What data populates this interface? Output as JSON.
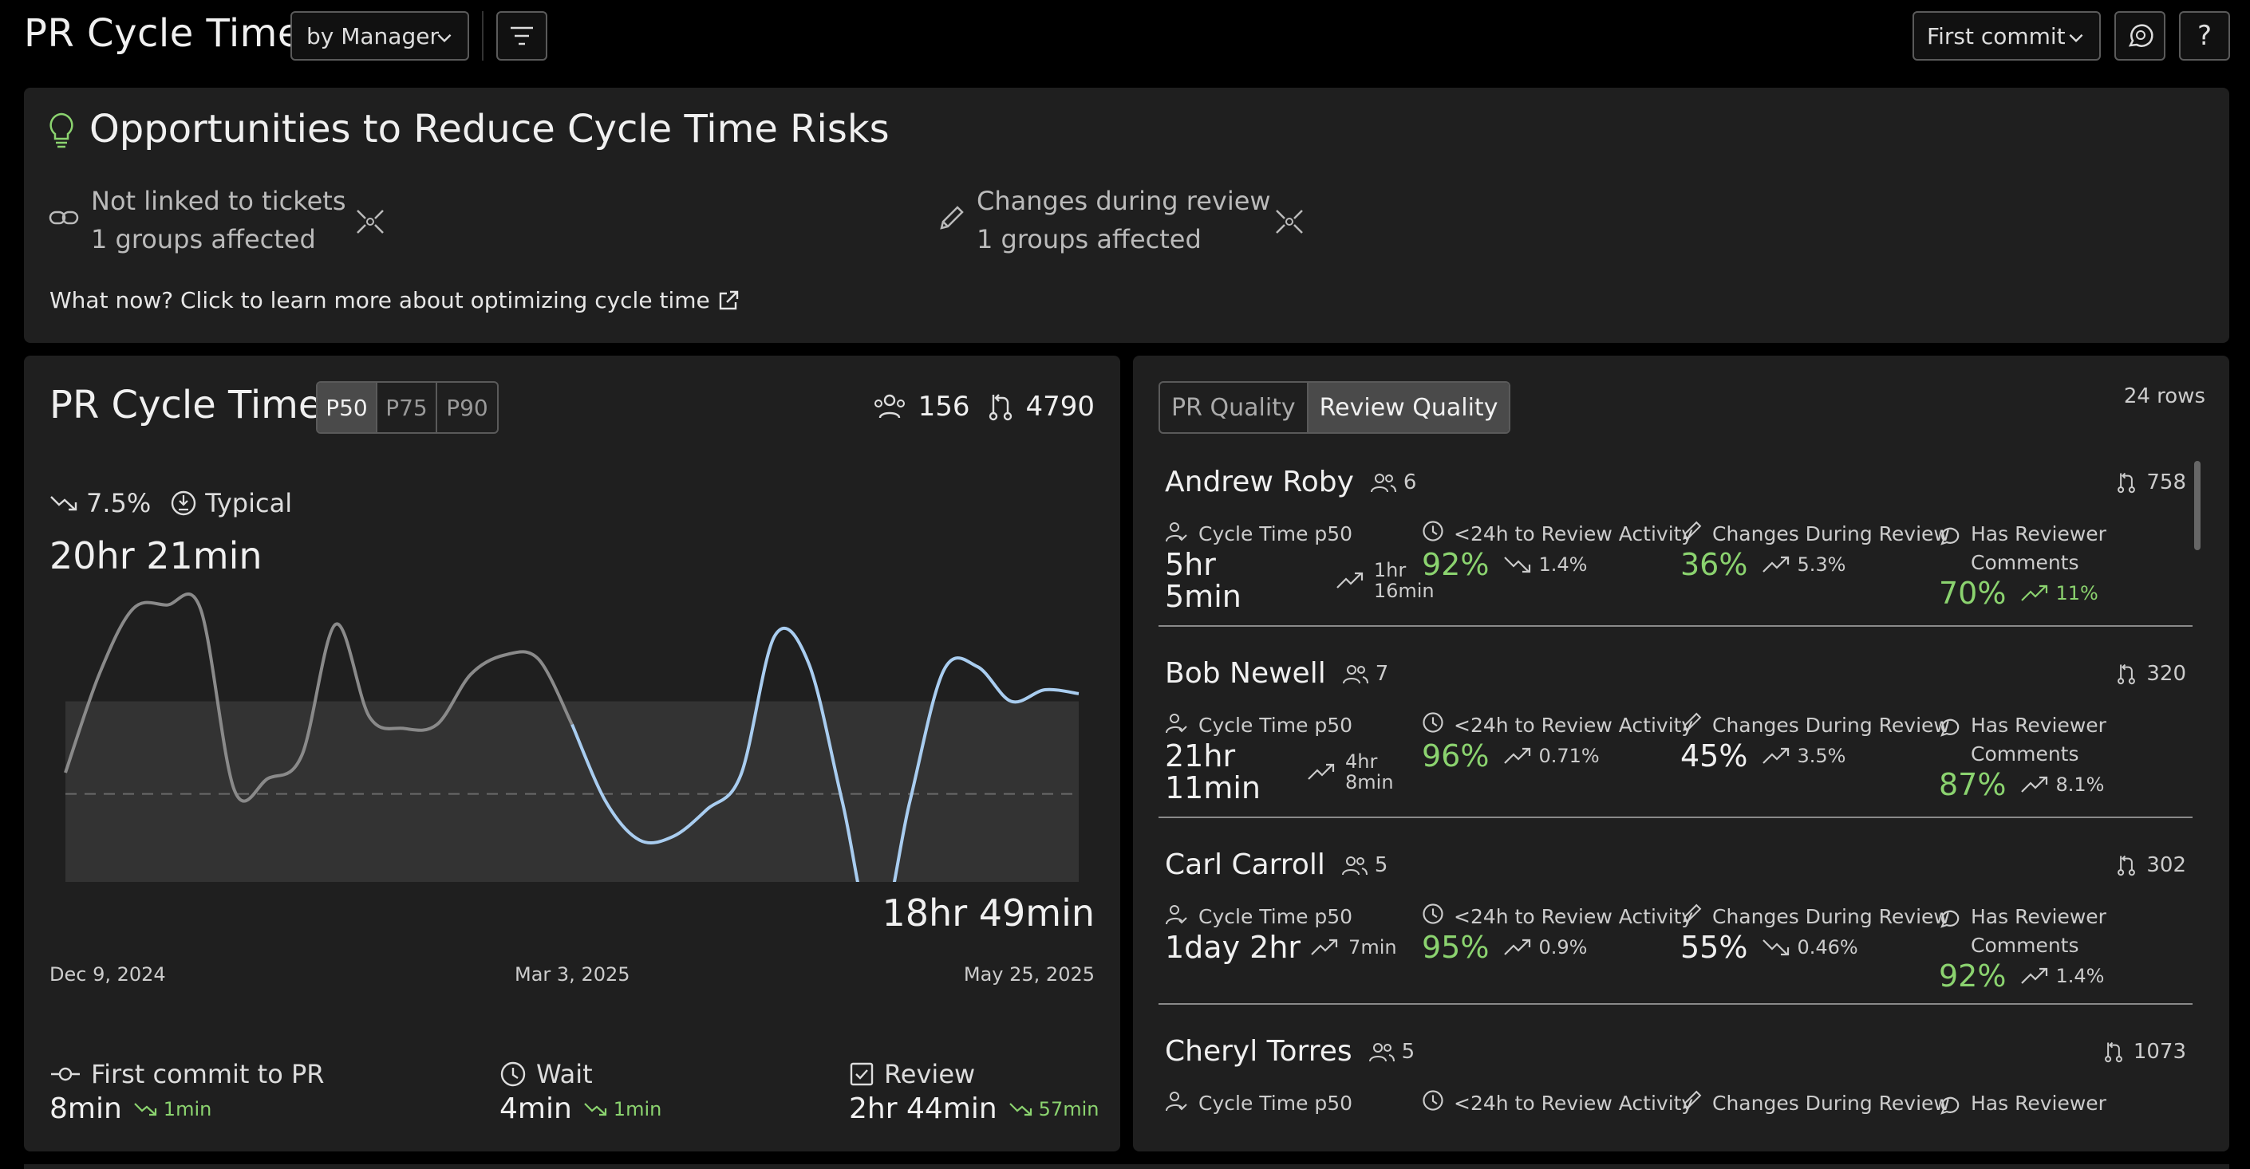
{
  "header": {
    "title": "PR Cycle Time",
    "group_by": "by Manager",
    "commit_select": "First commit",
    "help": "?"
  },
  "opportunities": {
    "title": "Opportunities to Reduce Cycle Time Risks",
    "items": [
      {
        "label": "Not linked to tickets",
        "affected": "1 groups affected"
      },
      {
        "label": "Changes during review",
        "affected": "1 groups affected"
      }
    ],
    "learn_more": "What now? Click to learn more about optimizing cycle time"
  },
  "cycle_time": {
    "title": "PR Cycle Time",
    "percentiles": [
      "P50",
      "P75",
      "P90"
    ],
    "active_percentile": "P50",
    "contributors": "156",
    "prs": "4790",
    "trend_pct": "7.5%",
    "typical_label": "Typical",
    "start_value": "20hr 21min",
    "end_value": "18hr 49min",
    "x_labels": [
      "Dec 9, 2024",
      "Mar 3, 2025",
      "May 25, 2025"
    ],
    "phases": [
      {
        "label": "First commit to PR",
        "value": "8min",
        "delta": "1min"
      },
      {
        "label": "Wait",
        "value": "4min",
        "delta": "1min"
      },
      {
        "label": "Review",
        "value": "2hr 44min",
        "delta": "57min"
      }
    ],
    "colors": {
      "line_gray": "#8a8a8a",
      "line_blue": "#a9cdf0",
      "band": "#333333",
      "positive": "#8bd36f"
    }
  },
  "chart_data": {
    "type": "line",
    "title": "",
    "xlabel": "",
    "ylabel": "",
    "x_ticks": [
      "Dec 9, 2024",
      "Mar 3, 2025",
      "May 25, 2025"
    ],
    "values": [
      20.35,
      22.9,
      24.6,
      24.7,
      24.6,
      19.9,
      20.2,
      20.8,
      24.2,
      21.8,
      21.5,
      21.6,
      22.9,
      23.4,
      23.3,
      21.6,
      19.6,
      18.6,
      18.7,
      19.4,
      20.3,
      23.9,
      23.2,
      19.6,
      15.9,
      19.6,
      23.0,
      23.1,
      22.2,
      22.5,
      22.4
    ],
    "typical_band_hours": [
      16.2,
      22.2
    ],
    "median_line_hours": 19.8,
    "start_label": "20hr 21min",
    "end_label": "18hr 49min"
  },
  "review_quality": {
    "tabs": [
      "PR Quality",
      "Review Quality"
    ],
    "active_tab": "Review Quality",
    "rows_count": "24 rows",
    "metric_labels": {
      "cycle": "Cycle Time p50",
      "review_activity": "<24h to Review Activity",
      "changes": "Changes During Review",
      "comments_1": "Has Reviewer",
      "comments_2": "Comments"
    },
    "rows": [
      {
        "name": "Andrew Roby",
        "members": "6",
        "prs": "758",
        "cycle_1": "5hr",
        "cycle_2": "5min",
        "cycle_delta_1": "1hr",
        "cycle_delta_2": "16min",
        "activity": "92%",
        "activity_delta": "1.4%",
        "changes": "36%",
        "changes_delta": "5.3%",
        "comments": "70%",
        "comments_delta": "11%"
      },
      {
        "name": "Bob Newell",
        "members": "7",
        "prs": "320",
        "cycle_1": "21hr",
        "cycle_2": "11min",
        "cycle_delta_1": "4hr",
        "cycle_delta_2": "8min",
        "activity": "96%",
        "activity_delta": "0.71%",
        "changes": "45%",
        "changes_delta": "3.5%",
        "comments": "87%",
        "comments_delta": "8.1%"
      },
      {
        "name": "Carl Carroll",
        "members": "5",
        "prs": "302",
        "cycle_1": "1day 2hr",
        "cycle_delta_1": "7min",
        "activity": "95%",
        "activity_delta": "0.9%",
        "changes": "55%",
        "changes_delta": "0.46%",
        "comments": "92%",
        "comments_delta": "1.4%"
      },
      {
        "name": "Cheryl Torres",
        "members": "5",
        "prs": "1073"
      }
    ]
  }
}
